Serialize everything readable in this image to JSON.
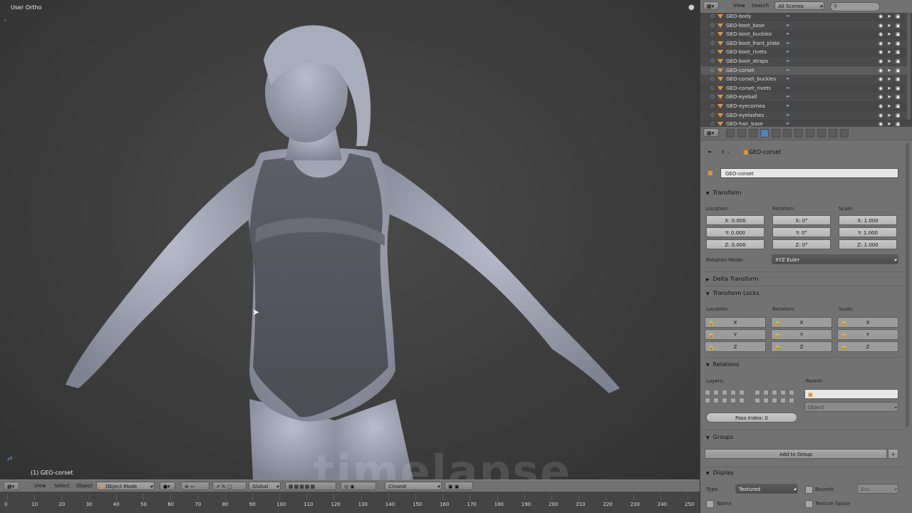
{
  "viewport": {
    "view_label": "User Ortho",
    "object_label": "(1) GEO-corset",
    "watermark": "timelapse"
  },
  "viewport_header": {
    "menus": [
      "View",
      "Select",
      "Object"
    ],
    "mode": "Object Mode",
    "orientation": "Global",
    "snap": "Closest"
  },
  "timeline": {
    "ticks": [
      "0",
      "10",
      "20",
      "30",
      "40",
      "50",
      "60",
      "70",
      "80",
      "90",
      "100",
      "110",
      "120",
      "130",
      "140",
      "150",
      "160",
      "170",
      "180",
      "190",
      "200",
      "210",
      "220",
      "230",
      "240",
      "250"
    ]
  },
  "outliner": {
    "menus": [
      "View",
      "Search"
    ],
    "scene_select": "All Scenes",
    "items": [
      "GEO-body",
      "GEO-boot_base",
      "GEO-boot_buckles",
      "GEO-boot_front_plate",
      "GEO-boot_rivets",
      "GEO-boot_straps",
      "GEO-corset",
      "GEO-corset_buckles",
      "GEO-corset_rivets",
      "GEO-eyeball",
      "GEO-eyecornea",
      "GEO-eyelashes",
      "GEO-hair_base"
    ],
    "selected_index": 6
  },
  "properties": {
    "breadcrumb": "GEO-corset",
    "object_name": "GEO-corset",
    "transform": {
      "title": "Transform",
      "location_label": "Location:",
      "rotation_label": "Rotation:",
      "scale_label": "Scale:",
      "location": [
        "X: 0.000",
        "Y: 0.000",
        "Z: 0.000"
      ],
      "rotation": [
        "X: 0°",
        "Y: 0°",
        "Z: 0°"
      ],
      "scale": [
        "X: 1.000",
        "Y: 1.000",
        "Z: 1.000"
      ],
      "rotation_mode_label": "Rotation Mode:",
      "rotation_mode": "XYZ Euler"
    },
    "delta_transform": "Delta Transform",
    "transform_locks": {
      "title": "Transform Locks",
      "location_label": "Location:",
      "rotation_label": "Rotation:",
      "scale_label": "Scale:",
      "axes": [
        "X",
        "Y",
        "Z"
      ]
    },
    "relations": {
      "title": "Relations",
      "layers_label": "Layers:",
      "parent_label": "Parent:",
      "parent_type": "Object",
      "pass_index": "Pass Index: 0"
    },
    "groups": {
      "title": "Groups",
      "add_button": "Add to Group"
    },
    "display": {
      "title": "Display",
      "type_label": "Type:",
      "type_value": "Textured",
      "bounds_label": "Bounds",
      "bounds_value": "Box",
      "name_label": "Name",
      "texture_space_label": "Texture Space"
    }
  },
  "colors": {
    "accent": "#5680c2",
    "object_icon": "#e49338",
    "panel_bg": "#727272",
    "viewport_bg": "#3d3d3d"
  }
}
